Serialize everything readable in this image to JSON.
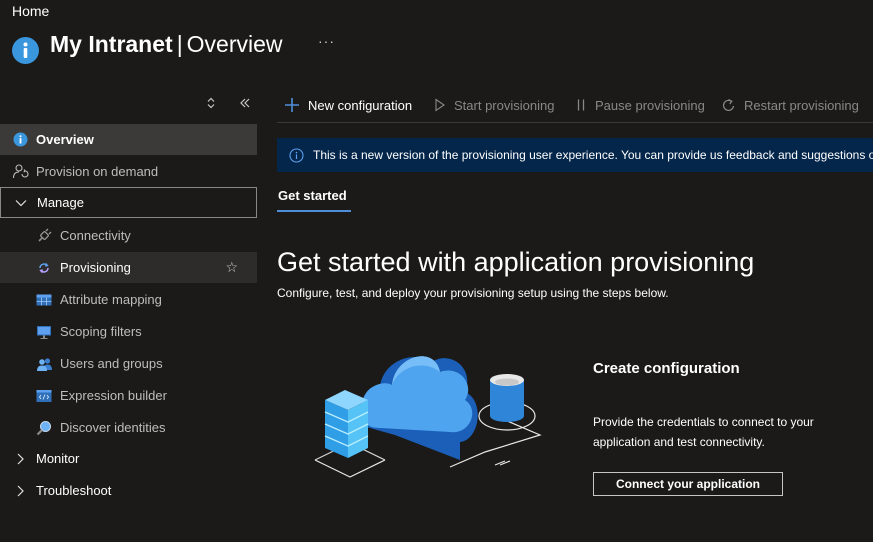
{
  "breadcrumb": "Home",
  "header": {
    "app_name": "My Intranet",
    "separator": "|",
    "section": "Overview",
    "more": "···"
  },
  "sidebar": {
    "items": [
      {
        "label": "Overview",
        "icon": "info-icon"
      },
      {
        "label": "Provision on demand",
        "icon": "person-sync-icon"
      },
      {
        "label": "Manage",
        "icon": "chevron-down-icon"
      },
      {
        "label": "Connectivity",
        "icon": "plug-icon"
      },
      {
        "label": "Provisioning",
        "icon": "provisioning-icon"
      },
      {
        "label": "Attribute mapping",
        "icon": "table-icon"
      },
      {
        "label": "Scoping filters",
        "icon": "monitor-icon"
      },
      {
        "label": "Users and groups",
        "icon": "users-icon"
      },
      {
        "label": "Expression builder",
        "icon": "code-icon"
      },
      {
        "label": "Discover identities",
        "icon": "magnifier-icon"
      },
      {
        "label": "Monitor",
        "icon": "chevron-right-icon"
      },
      {
        "label": "Troubleshoot",
        "icon": "chevron-right-icon"
      }
    ]
  },
  "toolbar": {
    "new_configuration": "New configuration",
    "start_provisioning": "Start provisioning",
    "pause_provisioning": "Pause provisioning",
    "restart_provisioning": "Restart provisioning"
  },
  "banner": {
    "text": "This is a new version of the provisioning user experience. You can provide us feedback and suggestions or"
  },
  "tabs": {
    "get_started": "Get started"
  },
  "main": {
    "title": "Get started with application provisioning",
    "subtitle": "Configure, test, and deploy your provisioning setup using the steps below.",
    "step_title": "Create configuration",
    "step_description": "Provide the credentials to connect to your application and test connectivity.",
    "connect_button": "Connect your application"
  },
  "colors": {
    "accent": "#4f8fd9",
    "info_icon": "#3a96dd",
    "banner_bg": "#04264b",
    "active_nav": "#3b3a39"
  }
}
